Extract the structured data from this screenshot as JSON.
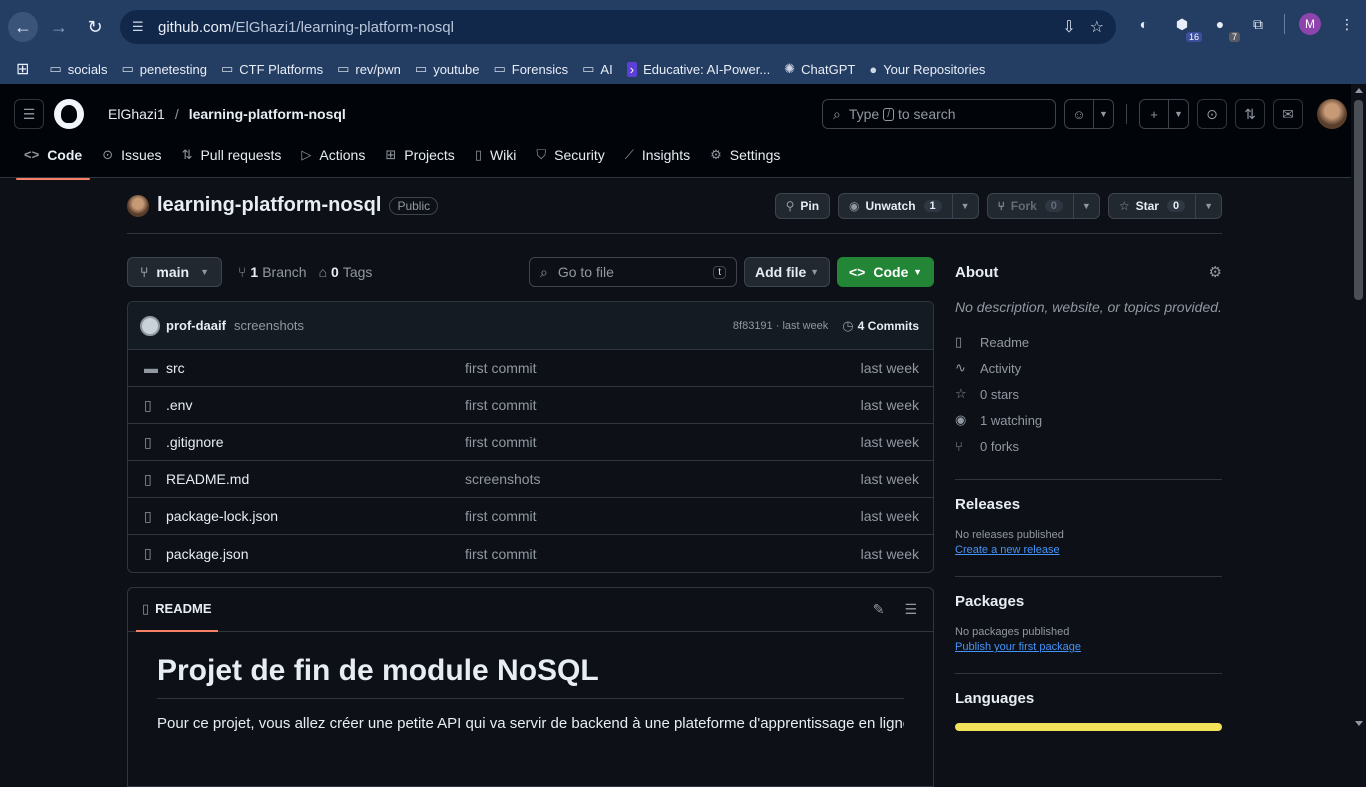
{
  "browser": {
    "url_host": "github.com",
    "url_path": "/ElGhazi1/learning-platform-nosql",
    "bookmarks": [
      "socials",
      "penetesting",
      "CTF Platforms",
      "rev/pwn",
      "youtube",
      "Forensics",
      "AI",
      "Educative: AI-Power...",
      "ChatGPT",
      "Your Repositories"
    ],
    "ext_badge_1": "16",
    "ext_badge_2": "7",
    "profile_initial": "M"
  },
  "header": {
    "owner": "ElGhazi1",
    "repo": "learning-platform-nosql",
    "search_pre": "Type",
    "search_key": "/",
    "search_post": "to search"
  },
  "tabs": [
    "Code",
    "Issues",
    "Pull requests",
    "Actions",
    "Projects",
    "Wiki",
    "Security",
    "Insights",
    "Settings"
  ],
  "repo": {
    "name": "learning-platform-nosql",
    "visibility": "Public",
    "pin_label": "Pin",
    "unwatch_label": "Unwatch",
    "watch_count": "1",
    "fork_label": "Fork",
    "fork_count": "0",
    "star_label": "Star",
    "star_count": "0"
  },
  "branch": {
    "name": "main",
    "branches_count": "1",
    "branches_label": "Branch",
    "tags_count": "0",
    "tags_label": "Tags",
    "goto_placeholder": "Go to file",
    "goto_key": "t",
    "add_file_label": "Add file",
    "code_label": "Code"
  },
  "commit": {
    "author": "prof-daaif",
    "message": "screenshots",
    "meta": "8f83191 · last week",
    "commits_label": "4 Commits"
  },
  "files": [
    {
      "name": "src",
      "type": "folder",
      "message": "first commit",
      "time": "last week"
    },
    {
      "name": ".env",
      "type": "file",
      "message": "first commit",
      "time": "last week"
    },
    {
      "name": ".gitignore",
      "type": "file",
      "message": "first commit",
      "time": "last week"
    },
    {
      "name": "README.md",
      "type": "file",
      "message": "screenshots",
      "time": "last week"
    },
    {
      "name": "package-lock.json",
      "type": "file",
      "message": "first commit",
      "time": "last week"
    },
    {
      "name": "package.json",
      "type": "file",
      "message": "first commit",
      "time": "last week"
    }
  ],
  "readme": {
    "tab_label": "README",
    "title": "Projet de fin de module NoSQL",
    "paragraph": "Pour ce projet, vous allez créer une petite API qui va servir de backend à une plateforme d'apprentissage en ligne. J'ai"
  },
  "about": {
    "title": "About",
    "description": "No description, website, or topics provided.",
    "readme": "Readme",
    "activity": "Activity",
    "stars": "0 stars",
    "watching": "1 watching",
    "forks": "0 forks"
  },
  "releases": {
    "title": "Releases",
    "empty": "No releases published",
    "link": "Create a new release"
  },
  "packages": {
    "title": "Packages",
    "empty": "No packages published",
    "link": "Publish your first package"
  },
  "languages": {
    "title": "Languages",
    "bar_color": "#f1e05a"
  }
}
